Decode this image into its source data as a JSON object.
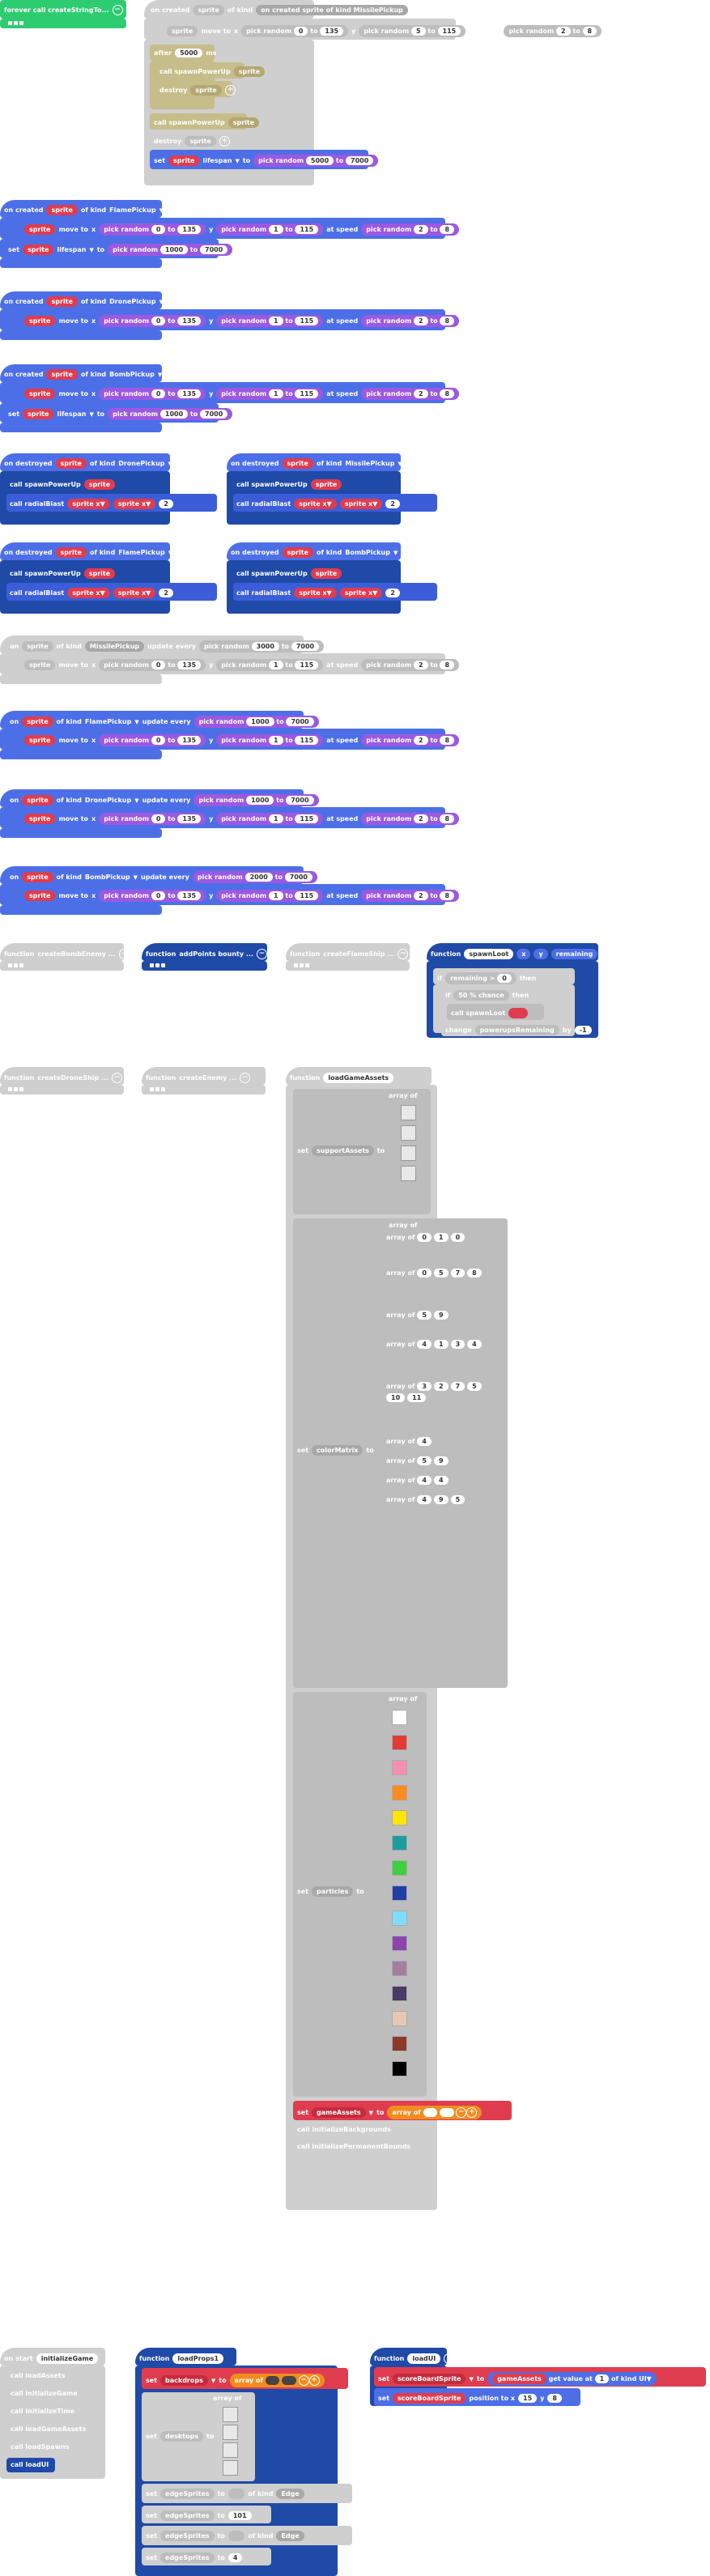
{
  "topleft": {
    "label": "forever call createStringTo...",
    "dots": "..."
  },
  "missile_disabled": {
    "hat": "on created sprite of kind MissilePickup",
    "move": [
      "sprite",
      "move to",
      "x",
      "pick random",
      "0",
      "to",
      "135",
      "y",
      "pick random",
      "5",
      "to",
      "115",
      "at speed",
      "pick random",
      "2",
      "to",
      "8"
    ],
    "after_label": "after",
    "after_val": "5000",
    "call": "call spawnPowerUp",
    "sprite": "sprite",
    "destroy": "destroy",
    "set_sprite": "sprite",
    "lifespan": "lifespan",
    "to": "to",
    "pick_random": "pick random",
    "life_a": "5000",
    "life_b": "7000",
    "set": "set"
  },
  "flame": {
    "hat_on": "on created",
    "sprite": "sprite",
    "of_kind": "of kind",
    "kind": "FlamePickup"
  },
  "drone": {
    "kind": "DronePickup"
  },
  "bomb": {
    "kind": "BombPickup"
  },
  "move_row": {
    "move_to": "move to",
    "x": "x",
    "pick_random": "pick random",
    "to": "to",
    "y": "y",
    "at_speed": "at speed",
    "v0": "0",
    "v135": "135",
    "v1": "1",
    "v115": "115",
    "v2": "2",
    "v8": "8"
  },
  "life_row": {
    "set": "set",
    "sprite": "sprite",
    "lifespan": "lifespan",
    "to": "to",
    "pick_random": "pick random",
    "a": "1000",
    "b": "7000"
  },
  "destroyed": {
    "on_destroyed": "on destroyed",
    "of_kind": "of kind",
    "k1": "DronePickup",
    "k2": "MissilePickup",
    "k3": "FlamePickup",
    "k4": "BombPickup",
    "call1": "call spawnPowerUp",
    "call2": "call radialBlast",
    "sprite": "sprite",
    "x": "x",
    "two": "2"
  },
  "updates": {
    "kind_missile": "MissilePickup",
    "kind_flame": "FlamePickup",
    "kind_drone": "DronePickup",
    "kind_bomb": "BombPickup",
    "on": "on",
    "update_every": "update every",
    "ms": "ms",
    "pick_random": "pick random",
    "a": "3000",
    "b": "7000",
    "c": "1000",
    "d": "7000",
    "e": "1000",
    "f": "7000",
    "g": "2000",
    "h": "7000",
    "sprite": "sprite",
    "of_kind": "of kind"
  },
  "functions": {
    "function": "function",
    "f1": "createBombEnemy ...",
    "f2": "addPoints bounty ...",
    "f3": "createFlameShip ...",
    "spawn": "spawnLoot",
    "x": "x",
    "y": "y",
    "remaining": "remaining",
    "if": "if",
    "gt": "> ",
    "zero": "0",
    "then": "then",
    "pick_chance": "50 % chance",
    "call_spawn": "call spawnLoot",
    "change": "change",
    "pw": "powerupsRemaining",
    "by": "by",
    "minus1": "-1",
    "f5": "createDroneShip ...",
    "f6": "createEnemy ...",
    "f7": "loadGameAssets",
    "array_of": "array of",
    "set": "set",
    "supportAssets": "supportAssets",
    "colorMatrix": "colorMatrix",
    "particles": "particles",
    "gameAssets": "gameAssets",
    "init1": "call initializeBackgrounds",
    "init2": "call initializePermanentBounds"
  },
  "colormatrix": {
    "rows": [
      [
        "0",
        "1",
        "0"
      ],
      [
        "0",
        "5",
        "7",
        "8"
      ],
      [
        "5",
        "9"
      ],
      [
        "4",
        "1",
        "3",
        "4"
      ],
      [
        "3",
        "2",
        "7",
        "5",
        "10",
        "11"
      ]
    ],
    "small": [
      [
        "4"
      ],
      [
        "5",
        "9"
      ],
      [
        "4",
        "4"
      ],
      [
        "4",
        "9",
        "5"
      ]
    ]
  },
  "particle_colors": [
    "#ffffff",
    "#e53935",
    "#f48fb1",
    "#ff8c1a",
    "#ffe400",
    "#1a9e9e",
    "#3dd13d",
    "#1f3ea8",
    "#7fdcff",
    "#8e44ad",
    "#a37e9e",
    "#4a3a6a",
    "#e6c8b0",
    "#8b3a2a",
    "#000000"
  ],
  "bottom": {
    "on_start": "on start",
    "init": "initializeGame",
    "calls": [
      "call loadAssets",
      "call initializeGame",
      "call initializeTime",
      "call loadGameAssets",
      "call loadSpawns"
    ],
    "call_load": "call loadUI",
    "f_props": "loadProps1",
    "backdrops": "backdrops",
    "array_of": "array of",
    "nesting": "desktops",
    "edgeSprite": "edgeSprites",
    "of_kind": "of kind",
    "edge": "Edge",
    "v101": "101",
    "v4": "4",
    "set": "set",
    "to": "to",
    "f_load": "loadUI",
    "scoreBoard": "scoreBoardSprite",
    "gameAssets": "gameAssets",
    "get_value": "get value at",
    "of_kind2": "of kind",
    "ui": "UI",
    "position": "position to x",
    "v15": "15",
    "y": "y",
    "v8": "8"
  }
}
